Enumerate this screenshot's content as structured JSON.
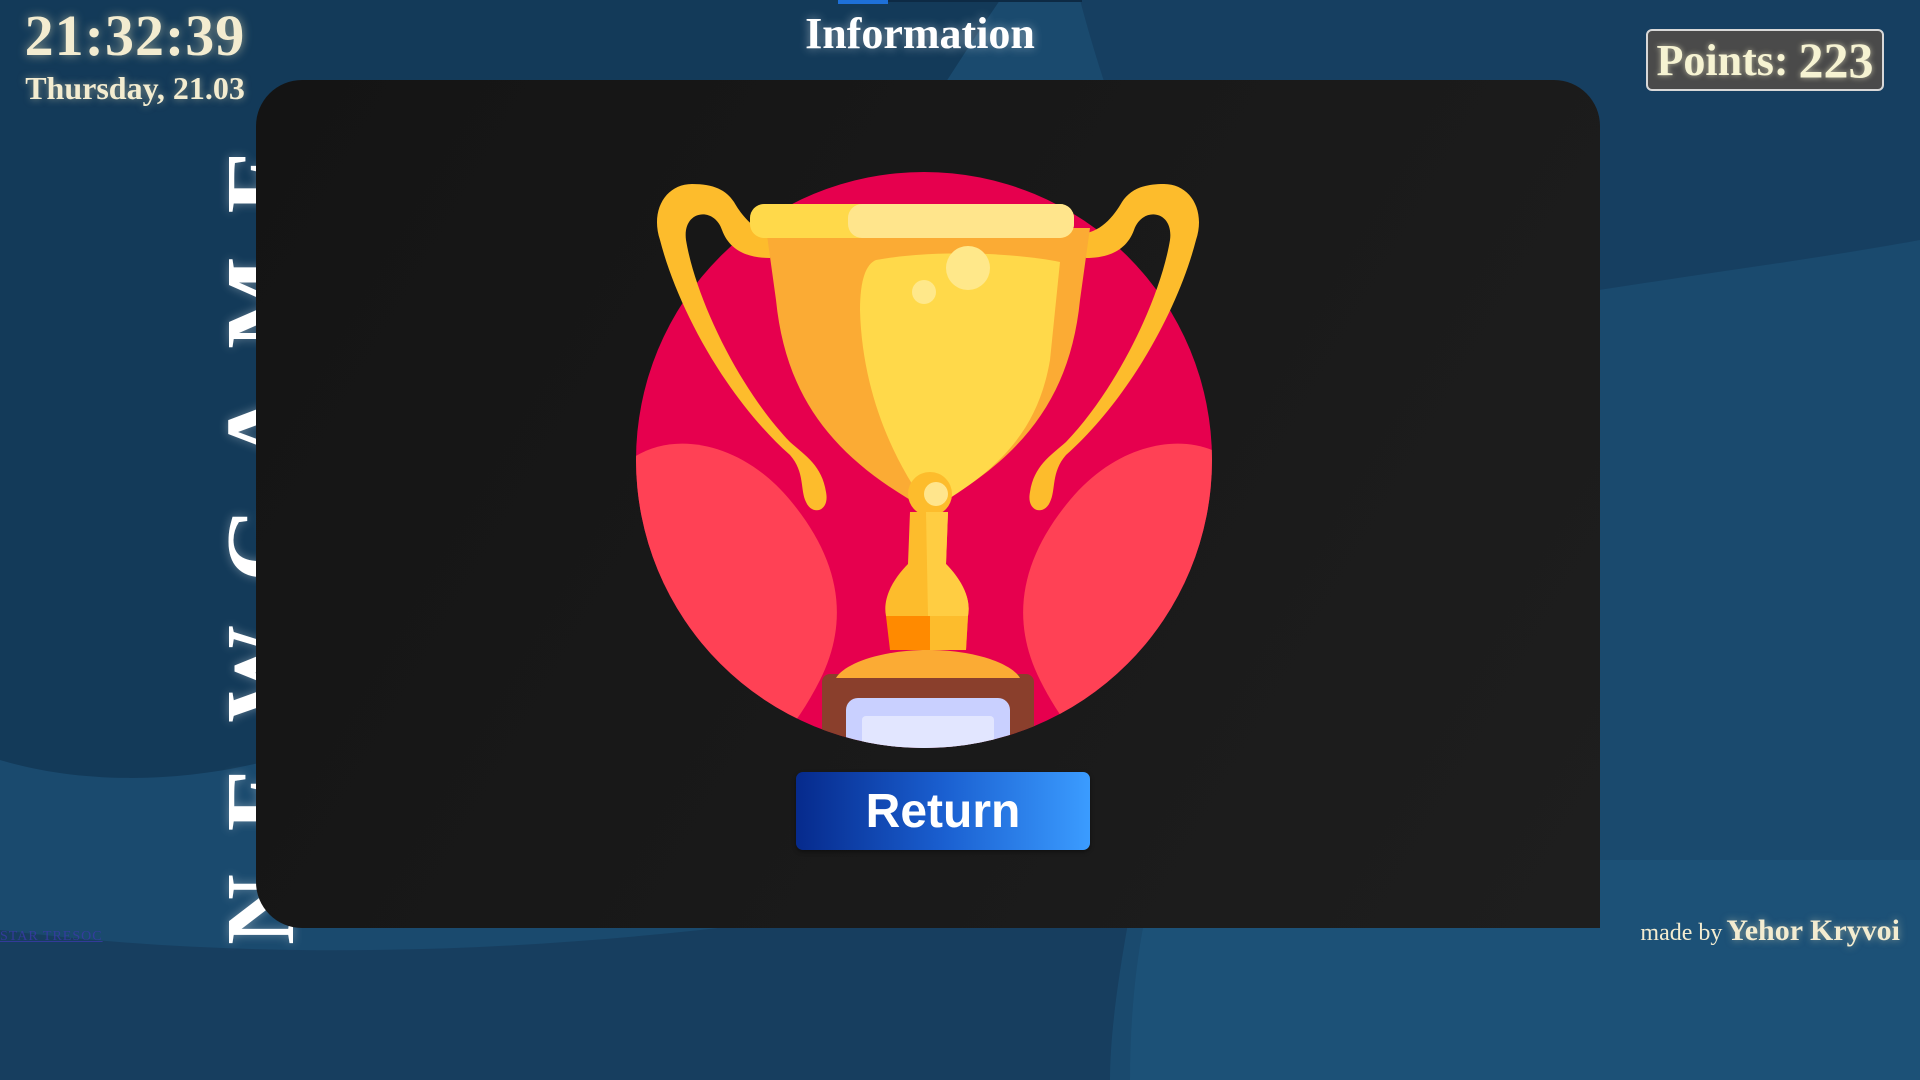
{
  "clock": {
    "time": "21:32:39",
    "date": "Thursday, 21.03"
  },
  "side_title": "NEWGAME",
  "side_link": "STAR TRESOC",
  "page_title": "Information",
  "points": {
    "label": "Points:",
    "value": "223"
  },
  "main": {
    "return_label": "Return"
  },
  "credits": {
    "made_by": "made by",
    "author": "Yehor Kryvoi"
  },
  "colors": {
    "background": "#1a4a6e",
    "panel": "#1a1a1a",
    "accent_button": "#1e6fe0",
    "text_cream": "#f3ecd0"
  }
}
